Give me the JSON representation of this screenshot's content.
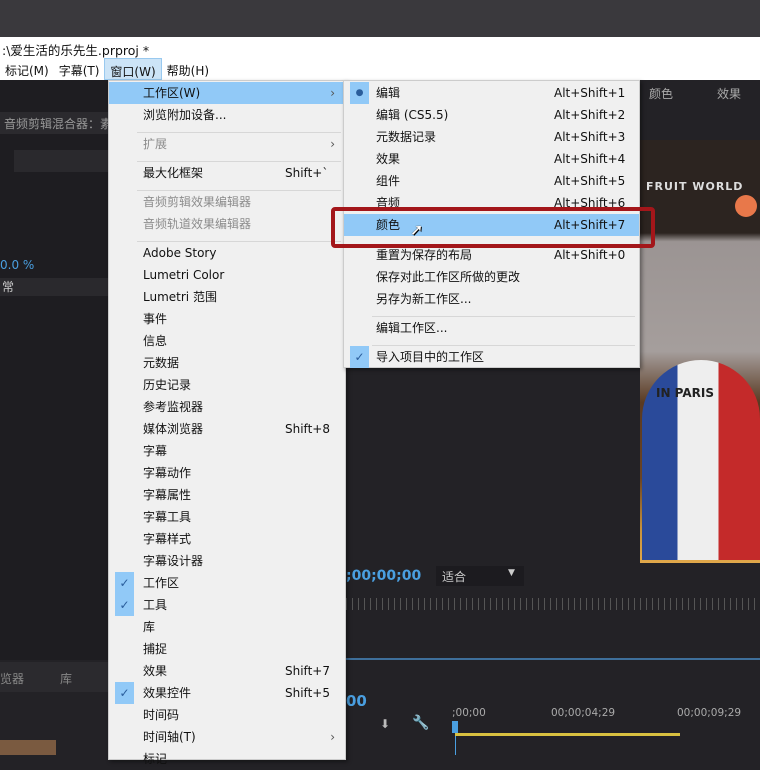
{
  "title": ":\\爱生活的乐先生.prproj *",
  "menubar": [
    "标记(M)",
    "字幕(T)",
    "窗口(W)",
    "帮助(H)"
  ],
  "left_panel": {
    "title": "音频剪辑混合器：素",
    "percent": "0.0 %",
    "mode": "常",
    "tabs": [
      "览器",
      "库"
    ]
  },
  "right_tabs": [
    "颜色",
    "效果"
  ],
  "monitor": {
    "timecode": ";00;00;00",
    "fit": "适合"
  },
  "timeline": {
    "timecode": "00",
    "ticks": [
      ";00;00",
      "00;00;04;29",
      "00;00;09;29"
    ]
  },
  "window_menu": [
    {
      "label": "工作区(W)",
      "sub": true,
      "highlight": true
    },
    {
      "label": "浏览附加设备..."
    },
    {
      "sep": true
    },
    {
      "label": "扩展",
      "sub": true,
      "disabled": true
    },
    {
      "sep": true
    },
    {
      "label": "最大化框架",
      "sc": "Shift+`"
    },
    {
      "sep": true
    },
    {
      "label": "音频剪辑效果编辑器",
      "disabled": true
    },
    {
      "label": "音频轨道效果编辑器",
      "disabled": true
    },
    {
      "sep": true
    },
    {
      "label": "Adobe Story"
    },
    {
      "label": "Lumetri Color"
    },
    {
      "label": "Lumetri 范围"
    },
    {
      "label": "事件"
    },
    {
      "label": "信息"
    },
    {
      "label": "元数据"
    },
    {
      "label": "历史记录"
    },
    {
      "label": "参考监视器"
    },
    {
      "label": "媒体浏览器",
      "sc": "Shift+8"
    },
    {
      "label": "字幕"
    },
    {
      "label": "字幕动作"
    },
    {
      "label": "字幕属性"
    },
    {
      "label": "字幕工具"
    },
    {
      "label": "字幕样式"
    },
    {
      "label": "字幕设计器"
    },
    {
      "label": "工作区",
      "checked": true
    },
    {
      "label": "工具",
      "checked": true
    },
    {
      "label": "库"
    },
    {
      "label": "捕捉"
    },
    {
      "label": "效果",
      "sc": "Shift+7"
    },
    {
      "label": "效果控件",
      "sc": "Shift+5",
      "checked": true
    },
    {
      "label": "时间码"
    },
    {
      "label": "时间轴(T)",
      "sub": true
    },
    {
      "label": "标记"
    }
  ],
  "workspace_menu": [
    {
      "label": "编辑",
      "sc": "Alt+Shift+1",
      "bullet": true
    },
    {
      "label": "编辑 (CS5.5)",
      "sc": "Alt+Shift+2"
    },
    {
      "label": "元数据记录",
      "sc": "Alt+Shift+3"
    },
    {
      "label": "效果",
      "sc": "Alt+Shift+4"
    },
    {
      "label": "组件",
      "sc": "Alt+Shift+5"
    },
    {
      "label": "音频",
      "sc": "Alt+Shift+6"
    },
    {
      "label": "颜色",
      "sc": "Alt+Shift+7",
      "highlight": true
    },
    {
      "gap": true
    },
    {
      "label": "重置为保存的布局",
      "sc": "Alt+Shift+0"
    },
    {
      "label": "保存对此工作区所做的更改"
    },
    {
      "label": "另存为新工作区..."
    },
    {
      "sep": true
    },
    {
      "label": "编辑工作区..."
    },
    {
      "sep": true
    },
    {
      "label": "导入项目中的工作区",
      "checked": true
    }
  ],
  "preview_text": [
    "FRUIT WORLD",
    "IN PARIS"
  ],
  "colors": {
    "highlight": "#91c9f7",
    "red_box": "#a3161a",
    "timecode": "#4a9fe0"
  }
}
